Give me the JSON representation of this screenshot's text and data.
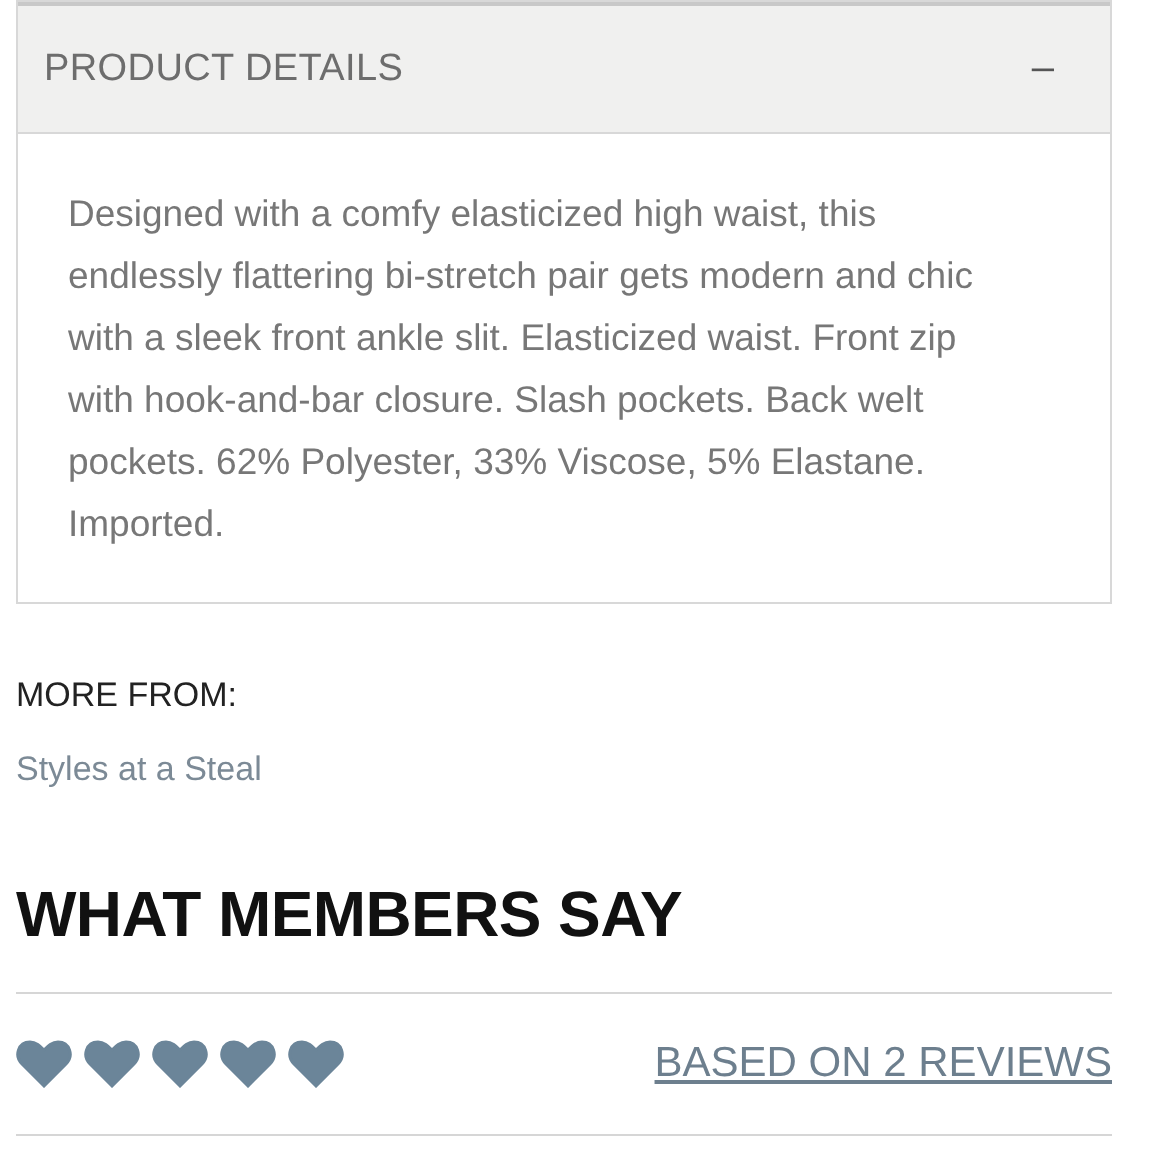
{
  "accordion": {
    "title": "PRODUCT DETAILS",
    "toggle": "–",
    "expanded": true,
    "description": "Designed with a comfy elasticized high waist, this endlessly flattering bi-stretch pair gets modern and chic with a sleek front ankle slit. Elasticized waist. Front zip with hook-and-bar closure. Slash pockets. Back welt pockets. 62% Polyester, 33% Viscose, 5% Elastane. Imported."
  },
  "more_from": {
    "label": "MORE FROM:",
    "link": "Styles at a Steal"
  },
  "reviews": {
    "heading": "WHAT MEMBERS SAY",
    "stars": 5,
    "summary_link": "BASED ON 2 REVIEWS"
  }
}
